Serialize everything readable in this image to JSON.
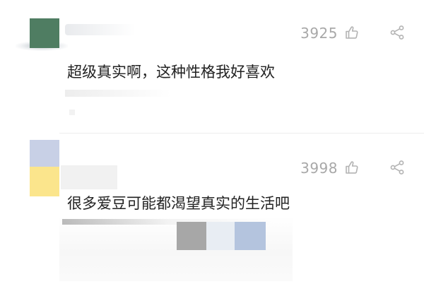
{
  "comments": [
    {
      "likes": "3925",
      "text": "超级真实啊，这种性格我好喜欢"
    },
    {
      "likes": "3998",
      "text": "很多爱豆可能都渴望真实的生活吧"
    }
  ],
  "icons": {
    "like": "thumbs-up-icon",
    "share": "share-icon"
  },
  "colors": {
    "text": "#222222",
    "count": "#a8a8a8",
    "avatar1": "#4f7d62",
    "avatar2_top": "#c8d0e6",
    "avatar2_bottom": "#fbe58c"
  }
}
